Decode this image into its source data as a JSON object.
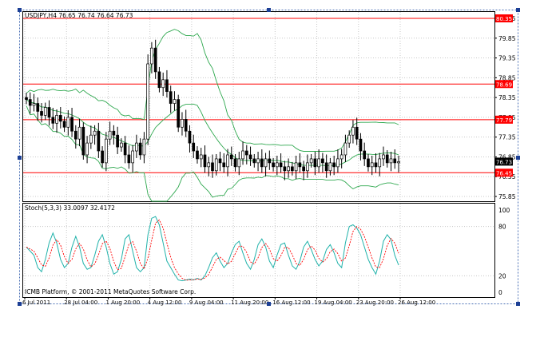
{
  "window": {
    "symbol_header": "USDJPY,H4  76.65 76.74 76.64 76.73",
    "copyright": "ICMB Platform, © 2001-2011 MetaQuotes Software Corp."
  },
  "price_axis": {
    "ticks": [
      "80.35",
      "79.85",
      "79.35",
      "78.85",
      "78.35",
      "77.85",
      "77.35",
      "76.85",
      "76.35",
      "75.85"
    ],
    "current_price": "76.73"
  },
  "resistance_lines": [
    {
      "value": 80.35,
      "label": "80.35"
    },
    {
      "value": 78.69,
      "label": "78.69"
    },
    {
      "value": 77.79,
      "label": "77.79"
    },
    {
      "value": 76.45,
      "label": "76.45"
    }
  ],
  "stochastic": {
    "label": "Stoch(5,3,3) 33.0097 32.4172",
    "ticks": [
      "100",
      "80",
      "20",
      "0"
    ]
  },
  "time_axis": {
    "labels": [
      "6 Jul 2011",
      "28 Jul 04:00",
      "1 Aug 20:00",
      "4 Aug 12:00",
      "9 Aug 04:00",
      "11 Aug 20:00",
      "16 Aug 12:00",
      "19 Aug 04:00",
      "23 Aug 20:00",
      "26 Aug 12:00"
    ]
  },
  "colors": {
    "candle": "#000000",
    "bollinger": "#2fa84f",
    "level_line": "#ff0000",
    "stoch_main": "#20b2aa",
    "stoch_signal": "#ff0000",
    "label_bg": "#ff0000"
  },
  "chart_data": {
    "type": "candlestick",
    "ylim": [
      75.85,
      80.35
    ],
    "close": [
      78.3,
      78.15,
      78.2,
      78.0,
      77.9,
      78.1,
      77.85,
      77.7,
      77.9,
      77.75,
      77.6,
      77.85,
      77.5,
      77.3,
      77.6,
      76.9,
      77.2,
      77.4,
      77.5,
      77.0,
      76.7,
      77.3,
      77.5,
      77.4,
      77.1,
      77.2,
      76.9,
      76.7,
      77.0,
      77.2,
      76.9,
      77.3,
      79.2,
      79.6,
      79.0,
      78.6,
      78.8,
      78.5,
      78.2,
      78.3,
      77.6,
      77.8,
      77.5,
      77.2,
      77.0,
      76.8,
      76.9,
      76.6,
      76.7,
      76.5,
      76.8,
      76.7,
      76.6,
      76.9,
      76.8,
      76.6,
      76.8,
      77.0,
      76.9,
      76.8,
      76.7,
      76.8,
      76.6,
      76.8,
      76.7,
      76.6,
      76.7,
      76.6,
      76.5,
      76.6,
      76.5,
      76.7,
      76.6,
      76.5,
      76.7,
      76.8,
      76.6,
      76.8,
      76.7,
      76.5,
      76.7,
      76.6,
      76.8,
      76.9,
      77.2,
      77.4,
      77.6,
      77.3,
      77.0,
      76.8,
      76.6,
      76.7,
      76.6,
      76.8,
      76.9,
      76.7,
      76.8,
      76.7,
      76.73
    ],
    "stoch_main": [
      55,
      50,
      45,
      30,
      25,
      40,
      60,
      72,
      60,
      40,
      30,
      35,
      55,
      68,
      55,
      35,
      28,
      30,
      45,
      62,
      70,
      55,
      35,
      22,
      25,
      40,
      65,
      70,
      50,
      30,
      25,
      30,
      70,
      90,
      92,
      82,
      60,
      38,
      30,
      22,
      15,
      14,
      15,
      16,
      15,
      17,
      15,
      20,
      30,
      42,
      48,
      38,
      30,
      35,
      48,
      58,
      62,
      48,
      35,
      28,
      40,
      58,
      65,
      55,
      38,
      30,
      45,
      58,
      60,
      45,
      32,
      28,
      38,
      55,
      62,
      52,
      40,
      32,
      38,
      52,
      58,
      48,
      35,
      30,
      60,
      80,
      82,
      78,
      70,
      55,
      40,
      30,
      22,
      38,
      62,
      70,
      64,
      45,
      33
    ]
  }
}
